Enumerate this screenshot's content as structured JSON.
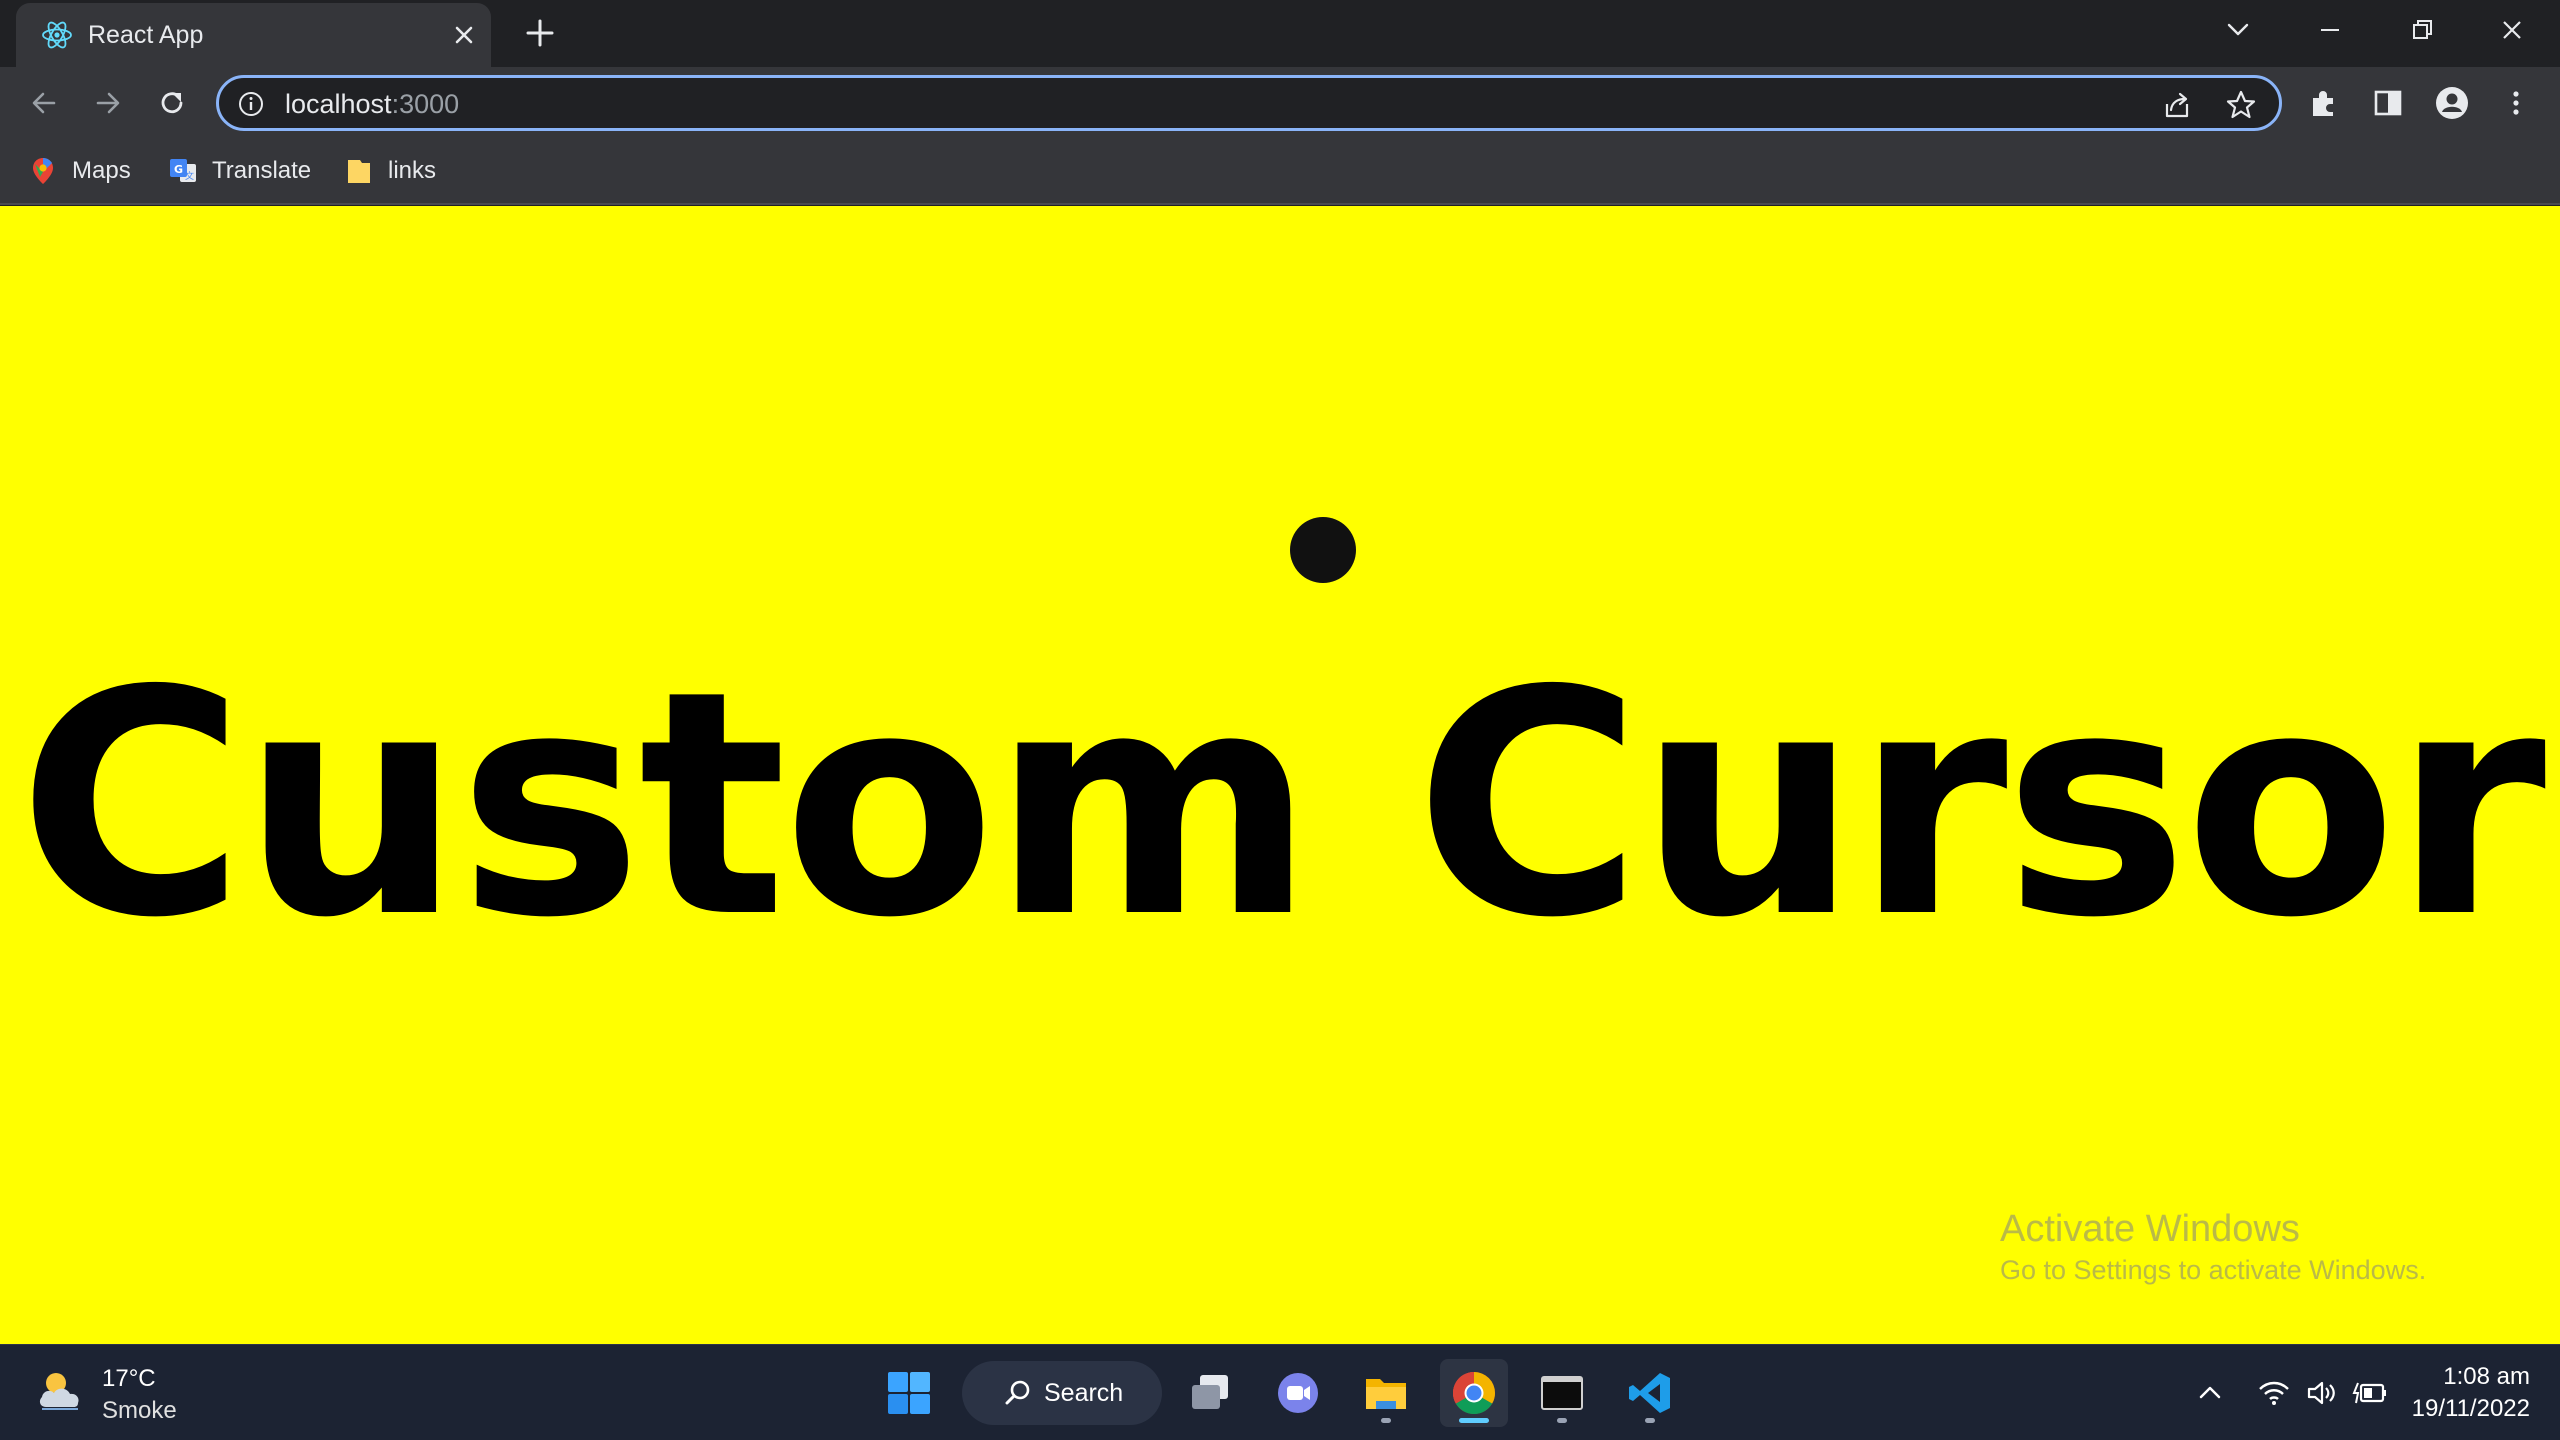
{
  "browser": {
    "tab": {
      "title": "React App",
      "favicon": "react-logo-icon"
    },
    "address_bar": {
      "host": "localhost",
      "port": ":3000"
    },
    "bookmarks": [
      {
        "label": "Maps",
        "icon": "google-maps-icon"
      },
      {
        "label": "Translate",
        "icon": "google-translate-icon"
      },
      {
        "label": "links",
        "icon": "folder-icon"
      }
    ]
  },
  "page": {
    "heading": "Custom Cursor",
    "background_color": "#ffff00",
    "cursor_color": "#111111"
  },
  "watermark": {
    "title": "Activate Windows",
    "subtitle": "Go to Settings to activate Windows."
  },
  "taskbar": {
    "weather": {
      "temperature": "17°C",
      "condition": "Smoke"
    },
    "search_label": "Search",
    "apps": [
      "start-icon",
      "task-view-icon",
      "teams-chat-icon",
      "file-explorer-icon",
      "chrome-icon",
      "terminal-icon",
      "vscode-icon"
    ],
    "clock": {
      "time": "1:08 am",
      "date": "19/11/2022"
    }
  }
}
